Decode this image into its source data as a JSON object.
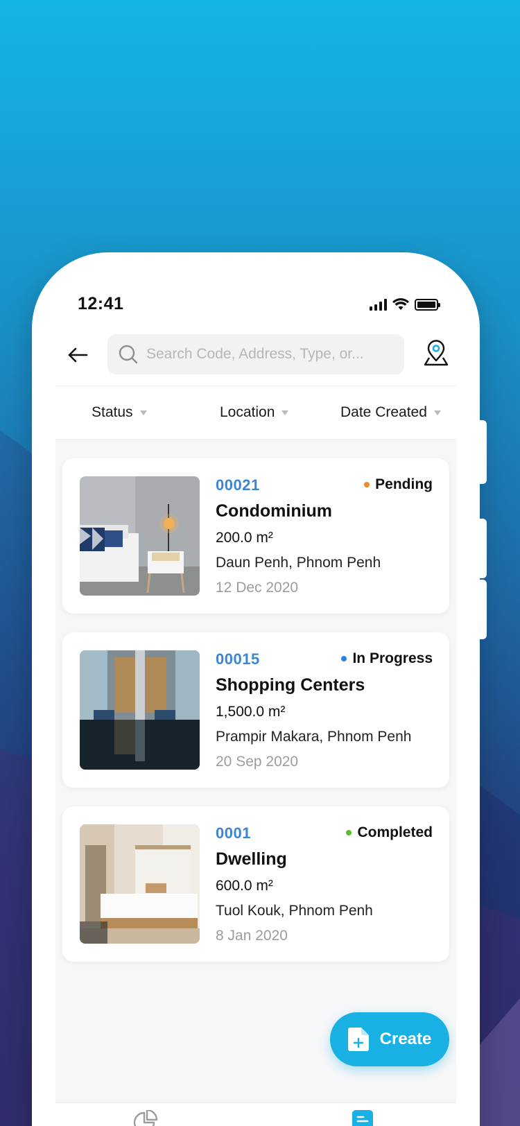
{
  "status_bar": {
    "time": "12:41"
  },
  "search": {
    "placeholder": "Search Code, Address, Type, or..."
  },
  "filters": [
    {
      "label": "Status"
    },
    {
      "label": "Location"
    },
    {
      "label": "Date Created"
    }
  ],
  "properties": [
    {
      "code": "00021",
      "status": "Pending",
      "status_color": "#f08a24",
      "type": "Condominium",
      "area": "200.0 m²",
      "address": "Daun Penh, Phnom Penh",
      "date": "12 Dec 2020",
      "image": "bedroom-photo"
    },
    {
      "code": "00015",
      "status": "In Progress",
      "status_color": "#2f80e0",
      "type": "Shopping Centers",
      "area": "1,500.0 m²",
      "address": "Prampir Makara, Phnom Penh",
      "date": "20 Sep 2020",
      "image": "lobby-photo"
    },
    {
      "code": "0001",
      "status": "Completed",
      "status_color": "#5cbd2c",
      "type": "Dwelling",
      "area": "600.0 m²",
      "address": "Tuol Kouk, Phnom Penh",
      "date": "8 Jan 2020",
      "image": "hotel-room-photo"
    }
  ],
  "fab": {
    "label": "Create"
  },
  "colors": {
    "accent": "#19b0e3",
    "code_blue": "#3a86d4"
  },
  "tabbar": {
    "items": [
      "dashboard-icon",
      "document-icon"
    ]
  }
}
